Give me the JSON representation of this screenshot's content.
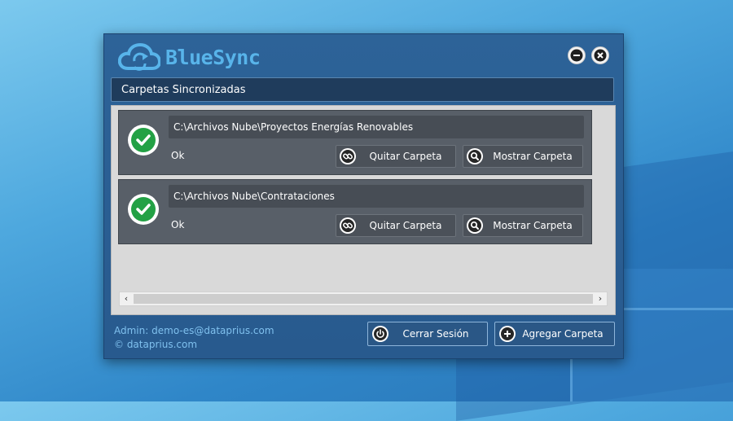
{
  "app": {
    "title": "BlueSync",
    "accent_color": "#58b4ea",
    "icons": {
      "logo": "cloud-sync-icon",
      "minimize": "minus-icon",
      "close": "close-icon"
    }
  },
  "section": {
    "title": "Carpetas Sincronizadas"
  },
  "folders": [
    {
      "path": "C:\\Archivos Nube\\Proyectos Energías Renovables",
      "status": "Ok",
      "status_icon": "check-circle-icon",
      "remove_label": "Quitar Carpeta",
      "show_label": "Mostrar Carpeta"
    },
    {
      "path": "C:\\Archivos Nube\\Contrataciones",
      "status": "Ok",
      "status_icon": "check-circle-icon",
      "remove_label": "Quitar Carpeta",
      "show_label": "Mostrar Carpeta"
    }
  ],
  "scrollbar": {
    "left_arrow": "‹",
    "right_arrow": "›"
  },
  "footer": {
    "admin_label": "Admin:",
    "admin_email": "demo-es@dataprius.com",
    "copyright": "© dataprius.com",
    "logout_label": "Cerrar Sesión",
    "add_label": "Agregar Carpeta"
  }
}
